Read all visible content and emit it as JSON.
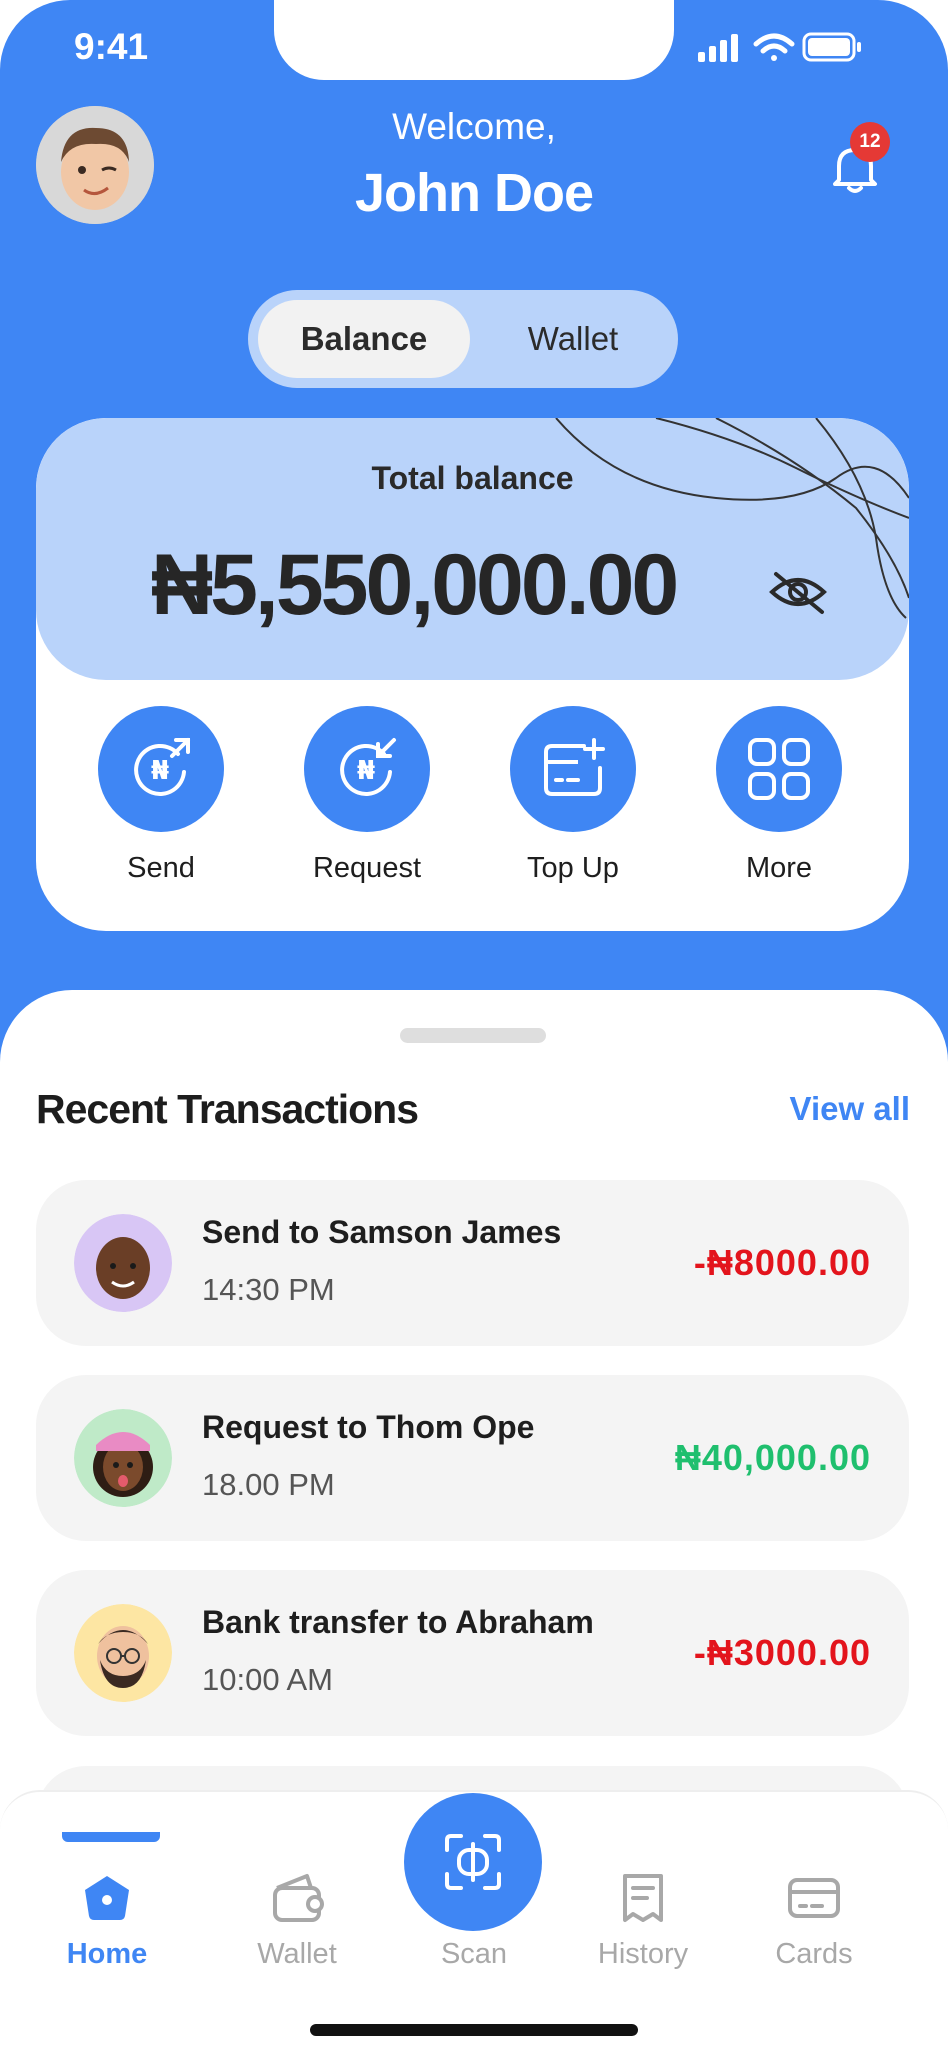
{
  "status_bar": {
    "time": "9:41"
  },
  "header": {
    "welcome": "Welcome,",
    "username": "John Doe",
    "notification_count": "12"
  },
  "toggle": {
    "active": "Balance",
    "inactive": "Wallet"
  },
  "balance_card": {
    "label": "Total balance",
    "amount": "₦5,550,000.00"
  },
  "actions": [
    {
      "label": "Send",
      "icon": "send-naira-icon"
    },
    {
      "label": "Request",
      "icon": "request-naira-icon"
    },
    {
      "label": "Top Up",
      "icon": "top-up-card-icon"
    },
    {
      "label": "More",
      "icon": "grid-icon"
    }
  ],
  "transactions_section": {
    "title": "Recent Transactions",
    "view_all": "View all"
  },
  "transactions": [
    {
      "title": "Send to Samson James",
      "time": "14:30 PM",
      "amount": "-₦8000.00",
      "type": "debit"
    },
    {
      "title": "Request to Thom Ope",
      "time": "18.00 PM",
      "amount": "₦40,000.00",
      "type": "credit"
    },
    {
      "title": "Bank transfer to Abraham",
      "time": "10:00 AM",
      "amount": "-₦3000.00",
      "type": "debit"
    }
  ],
  "colors": {
    "primary": "#3f86f4",
    "debit": "#e3141c",
    "credit": "#1fbf6e",
    "card_tint": "#b9d3fa"
  },
  "tabbar": [
    {
      "label": "Home",
      "icon": "home-icon",
      "active": true
    },
    {
      "label": "Wallet",
      "icon": "wallet-icon",
      "active": false
    },
    {
      "label": "Scan",
      "icon": "scan-icon",
      "active": false
    },
    {
      "label": "History",
      "icon": "receipt-icon",
      "active": false
    },
    {
      "label": "Cards",
      "icon": "card-icon",
      "active": false
    }
  ]
}
